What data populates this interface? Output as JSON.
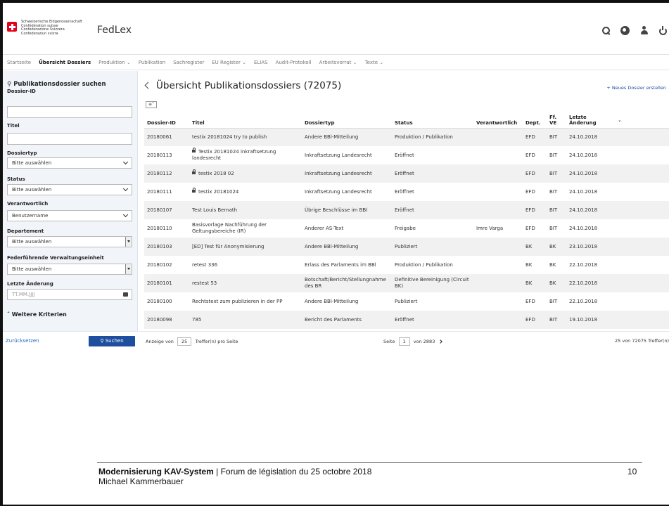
{
  "header": {
    "logo_lines": [
      "Schweizerische Eidgenossenschaft",
      "Confédération suisse",
      "Confederazione Svizzera",
      "Confederaziun svizra"
    ],
    "app_name": "FedLex",
    "icons": [
      "search-icon",
      "globe-icon",
      "user-icon",
      "power-icon"
    ]
  },
  "nav": {
    "items": [
      "Startseite",
      "Übersicht Dossiers",
      "Produktion",
      "Publikation",
      "Sachregister",
      "EU Register",
      "ELIAS",
      "Audit-Protokoll",
      "Arbeitsvorrat",
      "Texte"
    ],
    "dropdown_marker": "⌄"
  },
  "sidebar": {
    "title": "Publikationsdossier suchen",
    "fields": {
      "dossier_id_label": "Dossier-ID",
      "titel_label": "Titel",
      "dossiertyp_label": "Dossiertyp",
      "dossiertyp_value": "Bitte auswählen",
      "status_label": "Status",
      "status_value": "Bitte auswählen",
      "verantwortlich_label": "Verantwortlich",
      "verantwortlich_value": "Benutzername",
      "departement_label": "Departement",
      "departement_value": "Bitte auswählen",
      "ve_label": "Federführende Verwaltungseinheit",
      "ve_value": "Bitte auswählen",
      "aenderung_label": "Letzte Änderung",
      "aenderung_placeholder": "TT.MM.JJJJ"
    },
    "more_label": "Weitere Kriterien",
    "reset_label": "Zurücksetzen",
    "search_label": "Suchen"
  },
  "main": {
    "title": "Übersicht Publikationsdossiers (72075)",
    "new_dossier": "+ Neues Dossier erstellen",
    "columns": [
      "Dossier-ID",
      "Titel",
      "Dossiertyp",
      "Status",
      "Verantwortlich",
      "Dept.",
      "Ff. VE",
      "Letzte Änderung"
    ],
    "rows": [
      {
        "id": "20180061",
        "locked": false,
        "titel": "testix 20181024 try to publish",
        "typ": "Andere BBl-Mitteilung",
        "status": "Produktion / Publikation",
        "verantwortlich": "",
        "dept": "EFD",
        "ve": "BIT",
        "date": "24.10.2018"
      },
      {
        "id": "20180113",
        "locked": true,
        "titel": "Testix 20181024 inkraftsetzung landesrecht",
        "typ": "Inkraftsetzung Landesrecht",
        "status": "Eröffnet",
        "verantwortlich": "",
        "dept": "EFD",
        "ve": "BIT",
        "date": "24.10.2018"
      },
      {
        "id": "20180112",
        "locked": true,
        "titel": "testix 2018 02",
        "typ": "Inkraftsetzung Landesrecht",
        "status": "Eröffnet",
        "verantwortlich": "",
        "dept": "EFD",
        "ve": "BIT",
        "date": "24.10.2018"
      },
      {
        "id": "20180111",
        "locked": true,
        "titel": "testix 20181024",
        "typ": "Inkraftsetzung Landesrecht",
        "status": "Eröffnet",
        "verantwortlich": "",
        "dept": "EFD",
        "ve": "BIT",
        "date": "24.10.2018"
      },
      {
        "id": "20180107",
        "locked": false,
        "titel": "Test Louis Bernath",
        "typ": "Übrige Beschlüsse im BBl",
        "status": "Eröffnet",
        "verantwortlich": "",
        "dept": "EFD",
        "ve": "BIT",
        "date": "24.10.2018"
      },
      {
        "id": "20180110",
        "locked": false,
        "titel": "Basisvorlage Nachführung der Geltungsbereiche (IR)",
        "typ": "Anderer AS-Text",
        "status": "Freigabe",
        "verantwortlich": "Imre Varga",
        "dept": "EFD",
        "ve": "BIT",
        "date": "24.10.2018"
      },
      {
        "id": "20180103",
        "locked": false,
        "titel": "[ED] Test für Anonymisierung",
        "typ": "Andere BBl-Mitteilung",
        "status": "Publiziert",
        "verantwortlich": "",
        "dept": "BK",
        "ve": "BK",
        "date": "23.10.2018"
      },
      {
        "id": "20180102",
        "locked": false,
        "titel": "retest 336",
        "typ": "Erlass des Parlaments im BBl",
        "status": "Produktion / Publikation",
        "verantwortlich": "",
        "dept": "BK",
        "ve": "BK",
        "date": "22.10.2018"
      },
      {
        "id": "20180101",
        "locked": false,
        "titel": "restest 53",
        "typ": "Botschaft/Bericht/Stellungnahme des BR",
        "status": "Definitive Bereinigung (Circuit BK)",
        "verantwortlich": "",
        "dept": "BK",
        "ve": "BK",
        "date": "22.10.2018"
      },
      {
        "id": "20180100",
        "locked": false,
        "titel": "Rechtstext zum publizieren in der PP",
        "typ": "Andere BBl-Mitteilung",
        "status": "Publiziert",
        "verantwortlich": "",
        "dept": "EFD",
        "ve": "BIT",
        "date": "22.10.2018"
      },
      {
        "id": "20180098",
        "locked": false,
        "titel": "785",
        "typ": "Bericht des Parlaments",
        "status": "Eröffnet",
        "verantwortlich": "",
        "dept": "EFD",
        "ve": "BIT",
        "date": "19.10.2018"
      }
    ],
    "footer": {
      "show_prefix": "Anzeige von",
      "per_page": "25",
      "show_suffix": "Treffer(n) pro Seite",
      "page_prefix": "Seite",
      "page": "1",
      "page_suffix": "von 2883",
      "count": "25 von 72075 Treffer(n)"
    }
  },
  "slide_footer": {
    "title_bold": "Modernisierung KAV-System",
    "title_rest": " | Forum de législation du 25 octobre 2018",
    "author": "Michael Kammerbauer",
    "page_number": "10"
  }
}
